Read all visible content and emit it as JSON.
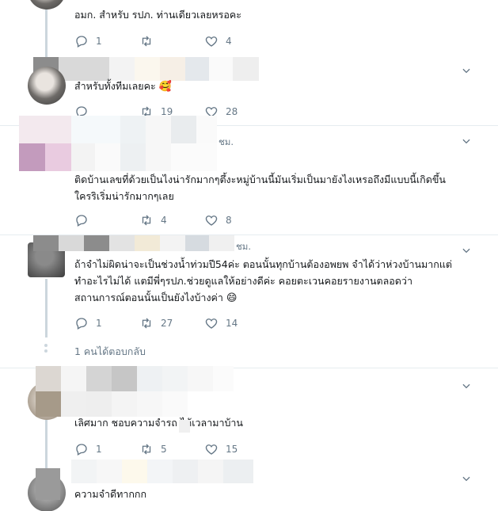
{
  "tweets": [
    {
      "text_lines": [
        "อมก. สำหรับ รปภ. ท่านเดียวเลยหรอคะ"
      ],
      "reply_count": "1",
      "retweet_count": "",
      "like_count": "4"
    },
    {
      "text_lines": [
        "สำหรับทั้งทีมเลยคะ"
      ],
      "emoji": "🥰",
      "reply_count": "",
      "retweet_count": "19",
      "like_count": "28"
    },
    {
      "handle_fragment": "ชม.",
      "text_lines": [
        "ติดบ้านเลขที่ด้วยเป็นไงน่ารักมากๆตึ้งะหมู่บ้านนี้มันเริ่มเป็นมายังไงเหรอถึงมีแบบนี้เกิดขึ้น",
        "ใครริเริ่มน่ารักมากๆเลย"
      ],
      "reply_count": "",
      "retweet_count": "4",
      "like_count": "8"
    },
    {
      "handle_fragment": "ชม.",
      "text_lines": [
        "ถ้าจำไม่ผิดน่าจะเป็นช่วงน้ำท่วมปี54ค่ะ ตอนนั้นทุกบ้านต้องอพยพ จำได้ว่าห่วงบ้านมากแต่",
        "ทำอะไรไม่ได้ แตมีพี่ๆรปภ.ช่วยดูแลให้อย่างดีค่ะ คอยตะเวนคอยรายงานตลอดว่า",
        "สถานการณ์ตอนนั้นเป็นยังไงบ้างค่า"
      ],
      "emoji": "😄",
      "reply_count": "1",
      "retweet_count": "27",
      "like_count": "14"
    },
    {
      "text_lines": [
        "เลิศมาก ชอบความจำรถ  ได้เวลามาบ้าน"
      ],
      "reply_count": "1",
      "retweet_count": "5",
      "like_count": "15"
    },
    {
      "text_lines": [
        "ความจำดีทากกก"
      ]
    }
  ],
  "more_replies_label": "1 คนได้ตอบกลับ",
  "icons": {
    "reply": "reply-icon",
    "retweet": "retweet-icon",
    "like": "heart-icon",
    "menu": "chevron-down-icon"
  },
  "colors": {
    "text": "#14171a",
    "muted": "#657786",
    "divider": "#e6ecf0",
    "thread": "#ccd6dd"
  }
}
